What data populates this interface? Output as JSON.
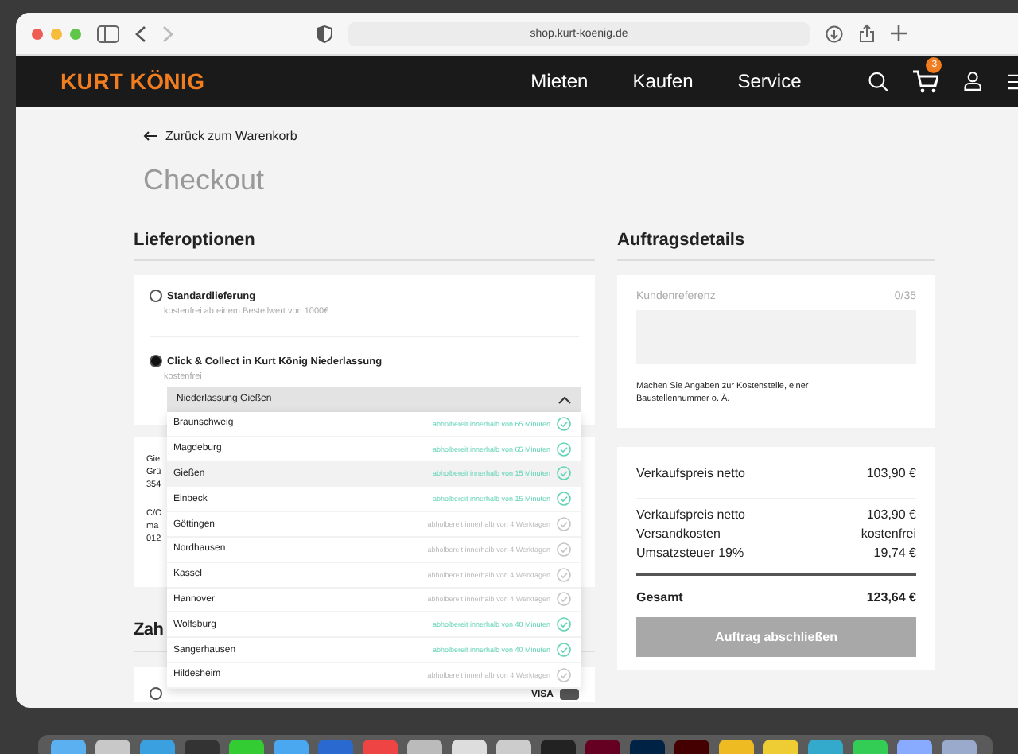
{
  "browser": {
    "url": "shop.kurt-koenig.de"
  },
  "header": {
    "logo": "KURT KÖNIG",
    "nav": [
      "Mieten",
      "Kaufen",
      "Service"
    ],
    "cart_count": "3"
  },
  "back_link": "Zurück zum Warenkorb",
  "page_title": "Checkout",
  "delivery": {
    "heading": "Lieferoptionen",
    "options": [
      {
        "label": "Standardlieferung",
        "note": "kostenfrei ab einem Bestellwert von 1000€",
        "selected": false
      },
      {
        "label": "Click & Collect in Kurt König Niederlassung",
        "note": "kostenfrei",
        "selected": true
      }
    ],
    "branch_select": {
      "value": "Niederlassung Gießen",
      "expanded": true,
      "branches": [
        {
          "name": "Braunschweig",
          "availability": "abholbereit innerhalb von 65 Minuten",
          "ready_soon": true,
          "selected": false
        },
        {
          "name": "Magdeburg",
          "availability": "abholbereit innerhalb von 65 Minuten",
          "ready_soon": true,
          "selected": false
        },
        {
          "name": "Gießen",
          "availability": "abholbereit innerhalb von 15 Minuten",
          "ready_soon": true,
          "selected": true
        },
        {
          "name": "Einbeck",
          "availability": "abholbereit innerhalb von 15 Minuten",
          "ready_soon": true,
          "selected": false
        },
        {
          "name": "Göttingen",
          "availability": "abholbereit innerhalb von 4 Werktagen",
          "ready_soon": false,
          "selected": false
        },
        {
          "name": "Nordhausen",
          "availability": "abholbereit innerhalb von 4 Werktagen",
          "ready_soon": false,
          "selected": false
        },
        {
          "name": "Kassel",
          "availability": "abholbereit innerhalb von 4 Werktagen",
          "ready_soon": false,
          "selected": false
        },
        {
          "name": "Hannover",
          "availability": "abholbereit innerhalb von 4 Werktagen",
          "ready_soon": false,
          "selected": false
        },
        {
          "name": "Wolfsburg",
          "availability": "abholbereit innerhalb von 40 Minuten",
          "ready_soon": true,
          "selected": false
        },
        {
          "name": "Sangerhausen",
          "availability": "abholbereit innerhalb von 40 Minuten",
          "ready_soon": true,
          "selected": false
        },
        {
          "name": "Hildesheim",
          "availability": "abholbereit innerhalb von 4 Werktagen",
          "ready_soon": false,
          "selected": false
        }
      ]
    },
    "address_blocks": [
      [
        "Gie",
        "Grü",
        "354"
      ],
      [
        "C/O",
        "ma",
        "012"
      ]
    ]
  },
  "payment": {
    "heading": "Zah",
    "method_selected": false,
    "card_brand": "VISA"
  },
  "order": {
    "heading": "Auftragsdetails",
    "reference": {
      "label": "Kundenreferenz",
      "counter": "0/35",
      "hint": "Machen Sie Angaben zur Kostenstelle, einer Baustellennummer o. Ä."
    },
    "summary": [
      {
        "label": "Verkaufspreis netto",
        "value": "103,90 €"
      }
    ],
    "details": [
      {
        "label": "Verkaufspreis netto",
        "value": "103,90 €"
      },
      {
        "label": "Versandkosten",
        "value": "kostenfrei"
      },
      {
        "label": "Umsatzsteuer 19%",
        "value": "19,74 €"
      }
    ],
    "total": {
      "label": "Gesamt",
      "value": "123,64 €"
    },
    "submit": {
      "label": "Auftrag abschließen",
      "disabled": true
    }
  }
}
